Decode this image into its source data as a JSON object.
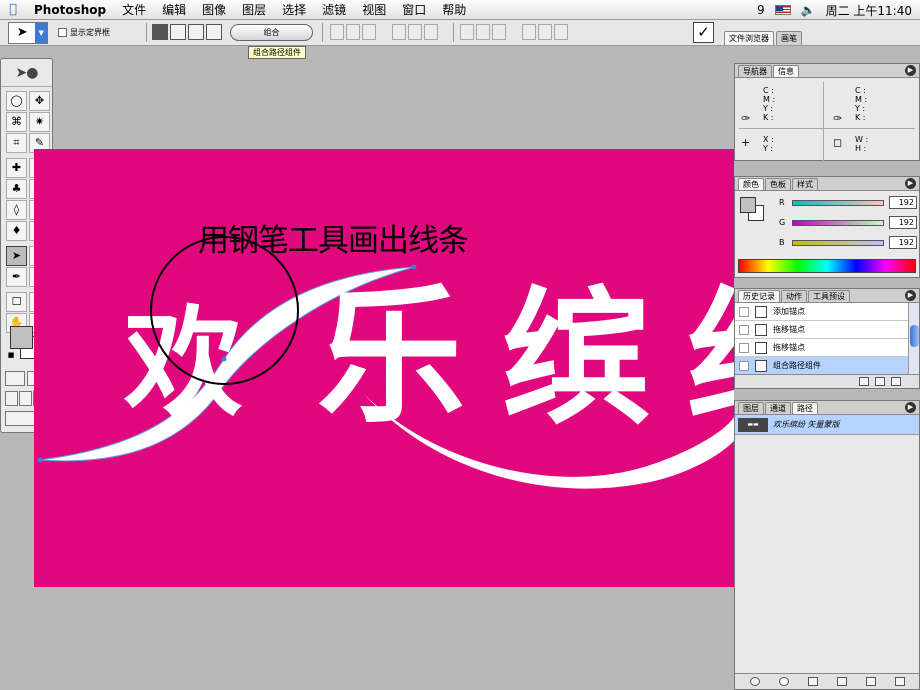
{
  "menubar": {
    "app": "Photoshop",
    "items": [
      "文件",
      "编辑",
      "图像",
      "图层",
      "选择",
      "滤镜",
      "视图",
      "窗口",
      "帮助"
    ],
    "clock": "周二 上午11:40",
    "status_glyph": "9"
  },
  "options": {
    "show_bbox_label": "显示定界框",
    "combine_label": "组合",
    "commit_glyph": "✓",
    "tooltip": "组合路径组件"
  },
  "well": {
    "tabs": [
      "文件浏览器",
      "画笔"
    ]
  },
  "canvas": {
    "caption": "用钢笔工具画出线条",
    "glyphs": [
      "欢",
      "乐",
      "缤",
      "纷"
    ],
    "background": "#e0087c"
  },
  "info_panel": {
    "tabs": [
      "导航器",
      "信息"
    ],
    "cmyk": "C :\nM :\nY :\nK :",
    "xy": "X :\nY :",
    "wh": "W :\nH :"
  },
  "color_panel": {
    "tabs": [
      "颜色",
      "色板",
      "样式"
    ],
    "channels": [
      {
        "label": "R",
        "value": "192"
      },
      {
        "label": "G",
        "value": "192"
      },
      {
        "label": "B",
        "value": "192"
      }
    ]
  },
  "history_panel": {
    "tabs": [
      "历史记录",
      "动作",
      "工具预设"
    ],
    "items": [
      "添加锚点",
      "拖移锚点",
      "拖移锚点",
      "组合路径组件"
    ],
    "selected_index": 3
  },
  "paths_panel": {
    "tabs": [
      "图层",
      "通道",
      "路径"
    ],
    "path_name": "欢乐缤纷 矢量蒙版"
  },
  "toolbox": {
    "tool_glyphs": [
      "◯",
      "✥",
      "⌘",
      "✷",
      "⌗",
      "✎",
      "✚",
      "✎",
      "♣",
      "✎",
      "◊",
      "◈",
      "♦",
      "◉",
      "➤",
      "T",
      "✒",
      "▭",
      "☐",
      "✐",
      "✋",
      "⚲"
    ]
  }
}
